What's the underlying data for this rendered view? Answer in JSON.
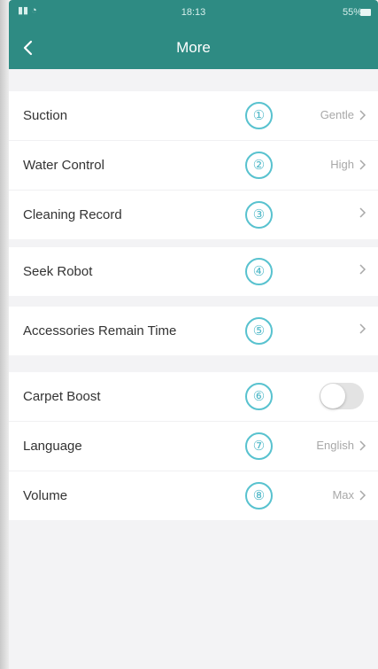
{
  "status_bar": {
    "signal": "••◦",
    "time": "18:13",
    "battery_text": "55%"
  },
  "header": {
    "title": "More",
    "back_icon": "chevron-left-icon"
  },
  "colors": {
    "header_bg": "#2e8b83",
    "annotation": "#58c2cf",
    "page_bg": "#f3f3f5"
  },
  "rows": [
    {
      "label": "Suction",
      "value": "Gentle",
      "annotation": "①"
    },
    {
      "label": "Water Control",
      "value": "High",
      "annotation": "②"
    },
    {
      "label": "Cleaning Record",
      "value": "",
      "annotation": "③"
    },
    {
      "label": "Seek Robot",
      "value": "",
      "annotation": "④"
    },
    {
      "label": "Accessories Remain Time",
      "value": "",
      "annotation": "⑤"
    },
    {
      "label": "Carpet Boost",
      "value": "",
      "annotation": "⑥",
      "toggle_on": false
    },
    {
      "label": "Language",
      "value": "English",
      "annotation": "⑦"
    },
    {
      "label": "Volume",
      "value": "Max",
      "annotation": "⑧"
    }
  ]
}
